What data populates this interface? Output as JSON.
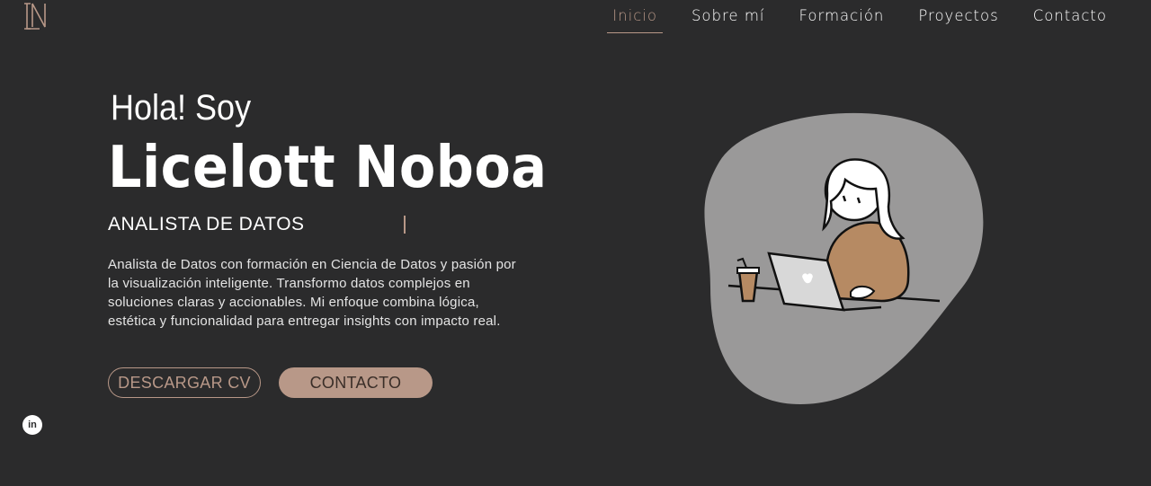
{
  "logo": {
    "letters": "LN"
  },
  "nav": {
    "items": [
      {
        "label": "Inicio",
        "active": true
      },
      {
        "label": "Sobre mí",
        "active": false
      },
      {
        "label": "Formación",
        "active": false
      },
      {
        "label": "Proyectos",
        "active": false
      },
      {
        "label": "Contacto",
        "active": false
      }
    ]
  },
  "hero": {
    "greeting": "Hola! Soy",
    "name": "Licelott Noboa",
    "role": "ANALISTA DE DATOS",
    "description": "Analista de Datos con formación en Ciencia de Datos y pasión por la visualización inteligente. Transformo datos complejos en soluciones claras y accionables. Mi enfoque combina lógica, estética y funcionalidad para entregar insights con impacto real.",
    "cv_button": "DESCARGAR CV",
    "contact_button": "CONTACTO"
  },
  "social": {
    "linkedin_icon": "linkedin-icon",
    "linkedin_text": "in"
  },
  "colors": {
    "background": "#2b2b2c",
    "accent": "#b89888",
    "blob": "#9a9999"
  }
}
